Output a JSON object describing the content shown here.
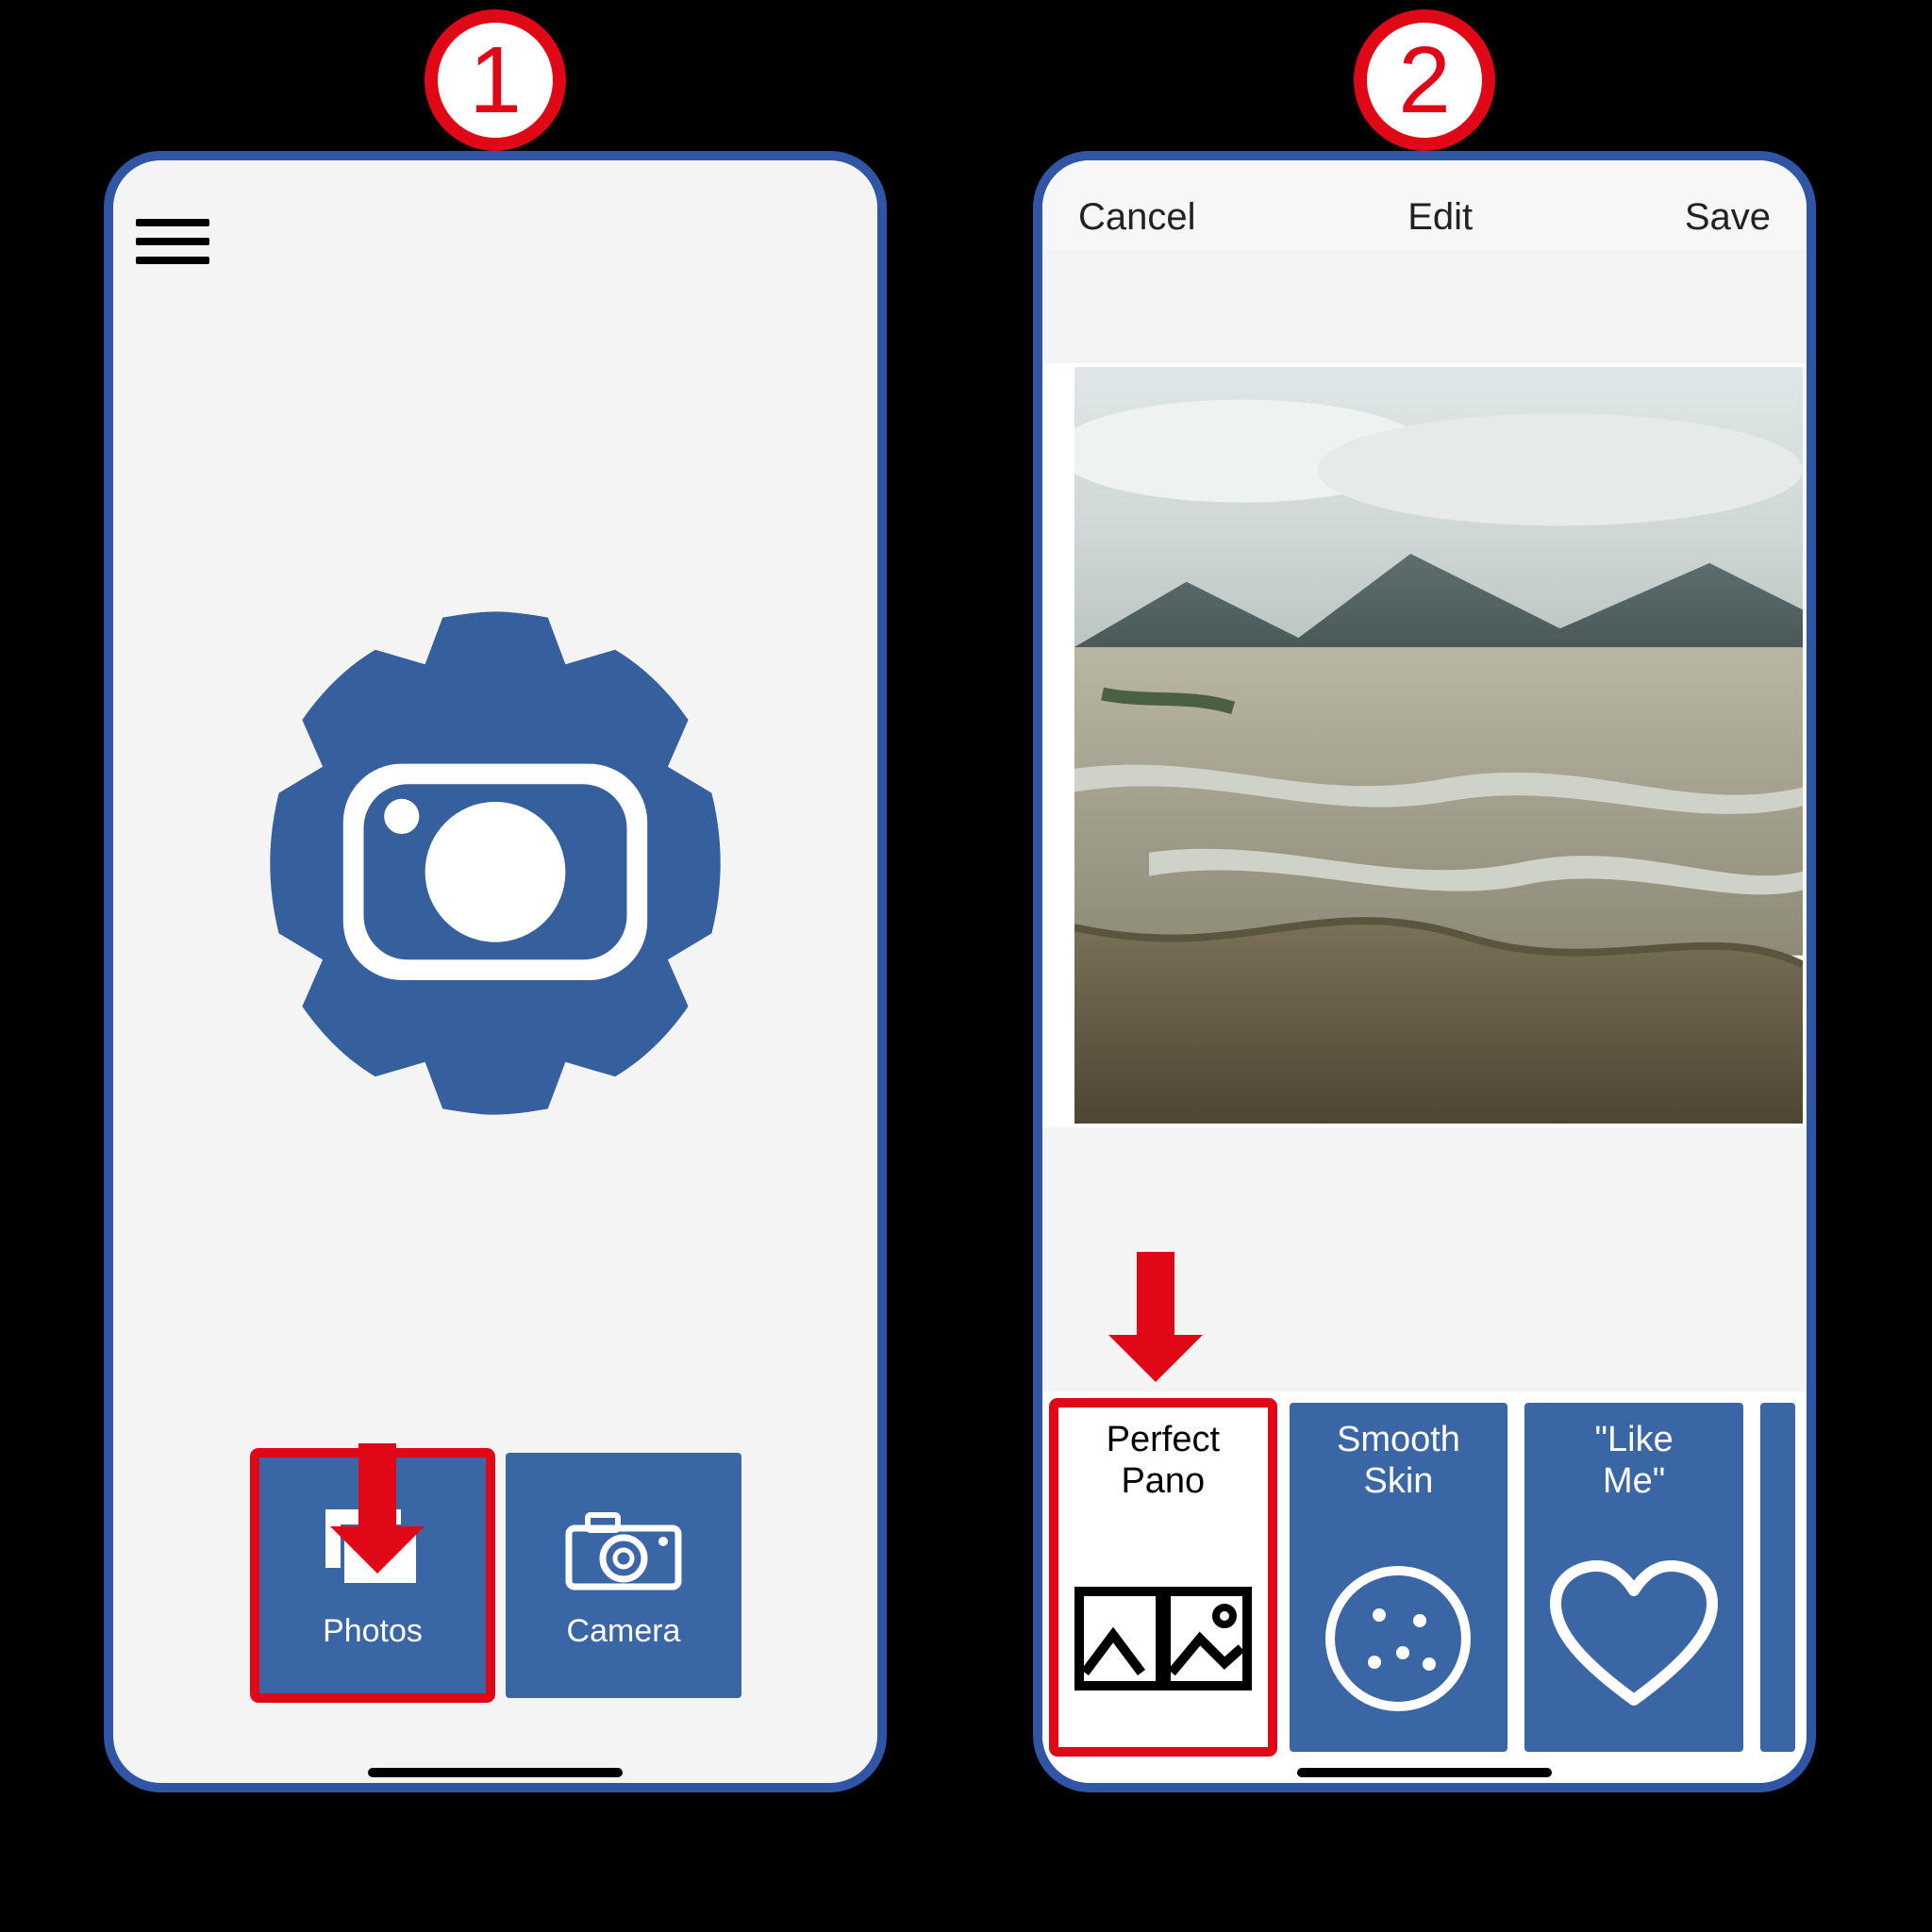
{
  "steps": {
    "one": "1",
    "two": "2"
  },
  "screen1": {
    "icons": {
      "menu": "menu-icon",
      "gear_camera": "gear-camera-icon",
      "photos": "photos-icon",
      "camera": "camera-icon"
    },
    "tiles": {
      "photos": "Photos",
      "camera": "Camera"
    }
  },
  "screen2": {
    "nav": {
      "cancel": "Cancel",
      "title": "Edit",
      "save": "Save"
    },
    "filters": [
      {
        "label_line1": "Perfect",
        "label_line2": "Pano",
        "icon": "panorama-icon",
        "selected": true
      },
      {
        "label_line1": "Smooth",
        "label_line2": "Skin",
        "icon": "face-dots-icon",
        "selected": false
      },
      {
        "label_line1": "\"Like",
        "label_line2": "Me\"",
        "icon": "heart-icon",
        "selected": false
      }
    ]
  },
  "colors": {
    "accent_blue": "#3a66a6",
    "frame_blue": "#2f55a4",
    "highlight_red": "#e00717"
  }
}
